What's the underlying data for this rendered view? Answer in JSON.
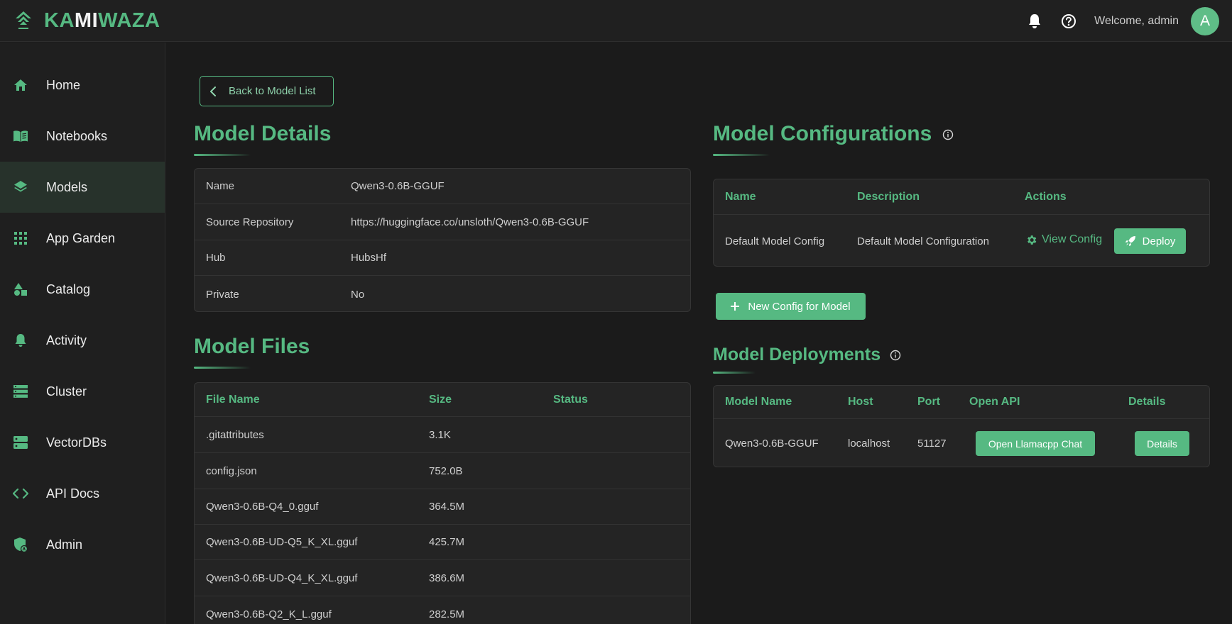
{
  "app": {
    "logo_text_a": "KA",
    "logo_text_b": "M",
    "logo_text_c": "I",
    "logo_text_d": "WAZA",
    "welcome": "Welcome, admin",
    "avatar_initial": "A",
    "accent_color": "#56b982"
  },
  "sidebar": {
    "items": [
      {
        "label": "Home",
        "icon": "home-icon"
      },
      {
        "label": "Notebooks",
        "icon": "book-icon"
      },
      {
        "label": "Models",
        "icon": "layers-icon",
        "active": true
      },
      {
        "label": "App Garden",
        "icon": "grid-icon"
      },
      {
        "label": "Catalog",
        "icon": "shapes-icon"
      },
      {
        "label": "Activity",
        "icon": "bell-icon"
      },
      {
        "label": "Cluster",
        "icon": "server-list-icon"
      },
      {
        "label": "VectorDBs",
        "icon": "database-icon"
      },
      {
        "label": "API Docs",
        "icon": "code-icon"
      },
      {
        "label": "Admin",
        "icon": "shield-user-icon"
      }
    ]
  },
  "main": {
    "back_label": "Back to Model List",
    "details": {
      "title": "Model Details",
      "rows": [
        {
          "label": "Name",
          "value": "Qwen3-0.6B-GGUF"
        },
        {
          "label": "Source Repository",
          "value": "https://huggingface.co/unsloth/Qwen3-0.6B-GGUF"
        },
        {
          "label": "Hub",
          "value": "HubsHf"
        },
        {
          "label": "Private",
          "value": "No"
        }
      ]
    },
    "files": {
      "title": "Model Files",
      "headers": [
        "File Name",
        "Size",
        "Status"
      ],
      "rows": [
        {
          "name": ".gitattributes",
          "size": "3.1K",
          "status": ""
        },
        {
          "name": "config.json",
          "size": "752.0B",
          "status": ""
        },
        {
          "name": "Qwen3-0.6B-Q4_0.gguf",
          "size": "364.5M",
          "status": ""
        },
        {
          "name": "Qwen3-0.6B-UD-Q5_K_XL.gguf",
          "size": "425.7M",
          "status": ""
        },
        {
          "name": "Qwen3-0.6B-UD-Q4_K_XL.gguf",
          "size": "386.6M",
          "status": ""
        },
        {
          "name": "Qwen3-0.6B-Q2_K_L.gguf",
          "size": "282.5M",
          "status": ""
        }
      ]
    },
    "configs": {
      "title": "Model Configurations",
      "headers": [
        "Name",
        "Description",
        "Actions"
      ],
      "rows": [
        {
          "name": "Default Model Config",
          "description": "Default Model Configuration",
          "view_label": "View Config",
          "deploy_label": "Deploy"
        }
      ],
      "new_label": "New Config for Model"
    },
    "deployments": {
      "title": "Model Deployments",
      "headers": [
        "Model Name",
        "Host",
        "Port",
        "Open API",
        "Details"
      ],
      "rows": [
        {
          "model": "Qwen3-0.6B-GGUF",
          "host": "localhost",
          "port": "51127",
          "open_label": "Open Llamacpp Chat",
          "details_label": "Details"
        }
      ]
    }
  }
}
